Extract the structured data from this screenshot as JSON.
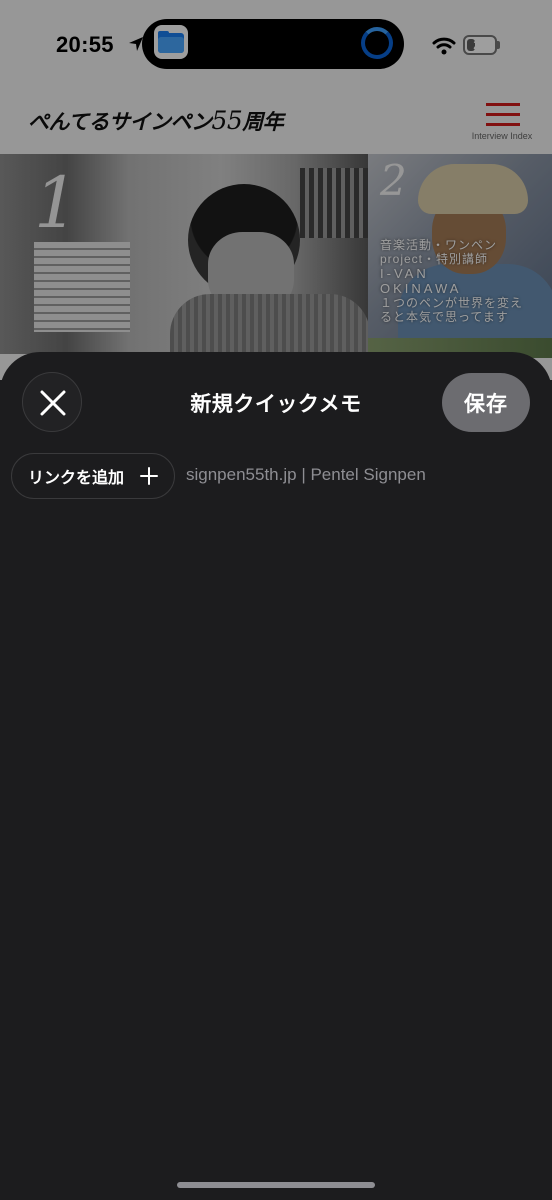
{
  "status_bar": {
    "time": "20:55",
    "battery_level": "28",
    "icons": [
      "location-arrow-icon",
      "files-app-icon",
      "activity-spinner-icon",
      "wifi-icon",
      "battery-icon"
    ]
  },
  "background_page": {
    "logo_text": "ぺんてるサインペン",
    "logo_number": "55",
    "logo_suffix": "周年",
    "menu_label": "Interview Index",
    "accent_color": "#d11a1a",
    "card1": {
      "number": "1"
    },
    "card2": {
      "number": "2",
      "caption_line1": "音楽活動・ワンペン",
      "caption_line2": "project・特別講師",
      "name_line1": "I-VAN",
      "name_line2": "OKINAWA",
      "caption_line3": "１つのペンが世界を変え",
      "caption_line4": "ると本気で思ってます"
    }
  },
  "sheet": {
    "title": "新規クイックメモ",
    "save_label": "保存",
    "add_link_label": "リンクを追加",
    "link_source": "signpen55th.jp | Pentel Signpen",
    "note_text": ""
  },
  "colors": {
    "sheet_bg": "#1c1c1e",
    "save_button_bg": "#6c6c70",
    "secondary_text": "#8e8e93"
  }
}
